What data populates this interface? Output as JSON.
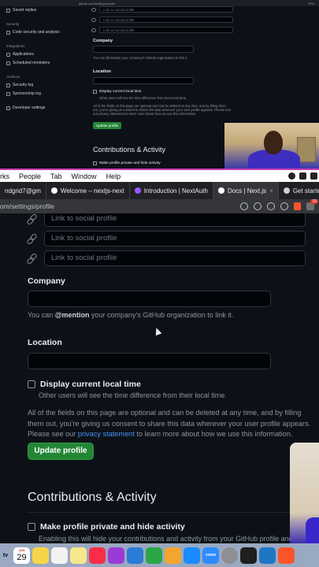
{
  "top_pane": {
    "url_bar": {
      "url": "github.com/settings/profile",
      "right": "VPN"
    },
    "sidebar": {
      "items": [
        {
          "label": "Saved replies",
          "icon": "reply-icon"
        },
        {
          "heading": "Security"
        },
        {
          "label": "Code security and analysis",
          "icon": "shield-icon"
        },
        {
          "heading": "Integrations"
        },
        {
          "label": "Applications",
          "icon": "apps-icon"
        },
        {
          "label": "Scheduled reminders",
          "icon": "clock-icon"
        },
        {
          "heading": "Archives"
        },
        {
          "label": "Security log",
          "icon": "log-icon"
        },
        {
          "label": "Sponsorship log",
          "icon": "log-icon"
        },
        {
          "label": "Developer settings",
          "icon": "code-icon"
        }
      ]
    },
    "main": {
      "social_placeholder": "Link to social profile",
      "company_label": "Company",
      "company_help": "You can @mention your company's GitHub organization to link it.",
      "location_label": "Location",
      "display_time_label": "Display current local time",
      "display_time_help": "Other users will see the time difference from their local time.",
      "notice": "All of the fields on this page are optional and can be deleted at any time, and by filling them out, you're giving us consent to share this data wherever your user profile appears. Please see our privacy statement to learn more about how we use this information.",
      "update_button": "Update profile",
      "contributions_title": "Contributions & Activity",
      "private_label": "Make profile private and hide activity"
    }
  },
  "menubar": {
    "items": [
      "rks",
      "People",
      "Tab",
      "Window",
      "Help"
    ]
  },
  "tabs": [
    {
      "label": "ndgrid7@gm",
      "favicon_color": "#ea4335"
    },
    {
      "label": "Welcome – nextjs-next",
      "favicon_color": "#ffffff"
    },
    {
      "label": "Introduction | NextAuth",
      "favicon_color": "#9b59ff"
    },
    {
      "label": "Docs | Next.js",
      "favicon_color": "#ffffff"
    },
    {
      "label": "Get started",
      "favicon_color": "#cfcfcf"
    }
  ],
  "urlbar": {
    "url": "om/settings/profile",
    "badge": "10"
  },
  "main": {
    "social_links": [
      {
        "placeholder": "Link to social profile"
      },
      {
        "placeholder": "Link to social profile"
      },
      {
        "placeholder": "Link to social profile"
      }
    ],
    "company": {
      "label": "Company",
      "help_prefix": "You can ",
      "help_mention": "@mention",
      "help_suffix": " your company's GitHub organization to link it."
    },
    "location": {
      "label": "Location"
    },
    "display_time": {
      "label": "Display current local time",
      "help": "Other users will see the time difference from their local time."
    },
    "notice": {
      "before_link": "All of the fields on this page are optional and can be deleted at any time, and by filling them out, you're giving us consent to share this data wherever your user profile appears. Please see our ",
      "link": "privacy statement",
      "after_link": " to learn more about how we use this information."
    },
    "update_button": "Update profile",
    "contributions_title": "Contributions & Activity",
    "private_option": {
      "label": "Make profile private and hide activity",
      "help": "Enabling this will hide your contributions and activity from your GitHub profile and"
    }
  },
  "dock": {
    "tv_label": "tv",
    "calendar": {
      "month": "JAN",
      "day": "29"
    },
    "zoom_label": "zoom",
    "apps": [
      {
        "name": "notes-icon",
        "color": "#f5d547"
      },
      {
        "name": "reminders-icon",
        "color": "#f2f2f2"
      },
      {
        "name": "notes2-icon",
        "color": "#f7e78d"
      },
      {
        "name": "music-icon",
        "color": "#fa2d48"
      },
      {
        "name": "podcasts-icon",
        "color": "#9b3bd6"
      },
      {
        "name": "keynote-icon",
        "color": "#2b7bd8"
      },
      {
        "name": "numbers-icon",
        "color": "#29a745"
      },
      {
        "name": "pages-icon",
        "color": "#f3a530"
      },
      {
        "name": "appstore-icon",
        "color": "#1a8cff"
      },
      {
        "name": "zoom-icon",
        "color": "#2d8cff"
      },
      {
        "name": "settings-icon",
        "color": "#8e8e93"
      },
      {
        "name": "terminal-icon",
        "color": "#1e1e1e"
      },
      {
        "name": "vscode-icon",
        "color": "#1f76c4"
      },
      {
        "name": "brave-icon",
        "color": "#fb542b"
      }
    ]
  }
}
